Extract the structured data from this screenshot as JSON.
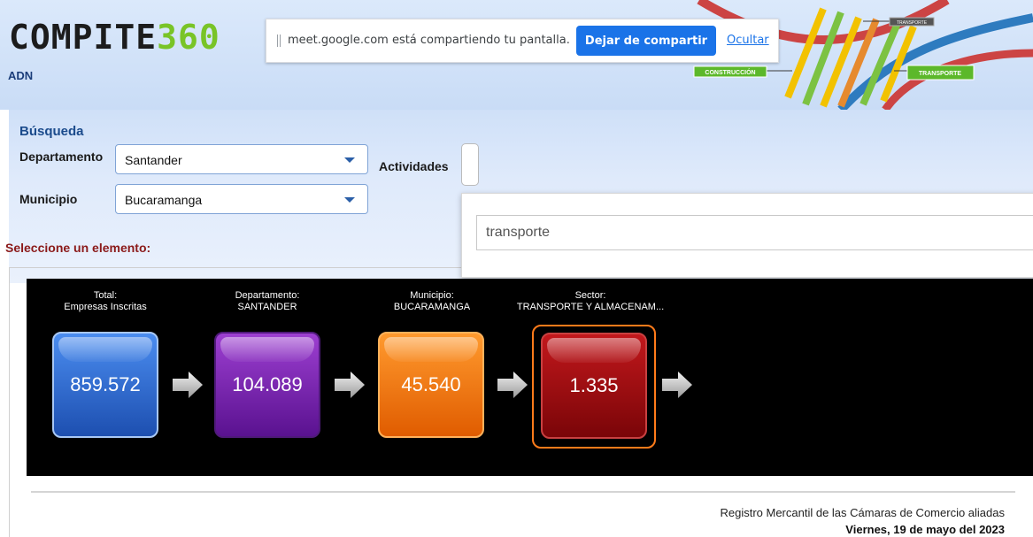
{
  "header": {
    "logo_part1": "COMPITE",
    "logo_part2": "360",
    "subtitle": "ADN",
    "dna_labels": {
      "construccion": "CONSTRUCCIÓN",
      "transporte": "TRANSPORTE",
      "transporte_top": "TRANSPORTE"
    }
  },
  "share_bar": {
    "message": "meet.google.com está compartiendo tu pantalla.",
    "stop_label": "Dejar de compartir",
    "hide_label": "Ocultar"
  },
  "search": {
    "title": "Búsqueda",
    "departamento_label": "Departamento",
    "departamento_value": "Santander",
    "municipio_label": "Municipio",
    "municipio_value": "Bucaramanga",
    "actividades_label": "Actividades",
    "activity_query": "transporte",
    "prompt": "Seleccione un elemento:"
  },
  "funnel": [
    {
      "caption_top": "Total:",
      "caption_bottom": "Empresas Inscritas",
      "value": "859.572"
    },
    {
      "caption_top": "Departamento:",
      "caption_bottom": "SANTANDER",
      "value": "104.089"
    },
    {
      "caption_top": "Municipio:",
      "caption_bottom": "BUCARAMANGA",
      "value": "45.540"
    },
    {
      "caption_top": "Sector:",
      "caption_bottom": "TRANSPORTE Y ALMACENAM...",
      "value": "1.335"
    }
  ],
  "footer": {
    "source": "Registro Mercantil de las Cámaras de Comercio aliadas",
    "date": "Viernes, 19 de mayo del 2023"
  },
  "colors": {
    "tile_total": "#2f6fd6",
    "tile_departamento": "#7a28b0",
    "tile_municipio": "#f27c12",
    "tile_sector": "#a00d10",
    "share_button": "#1a73e8"
  }
}
